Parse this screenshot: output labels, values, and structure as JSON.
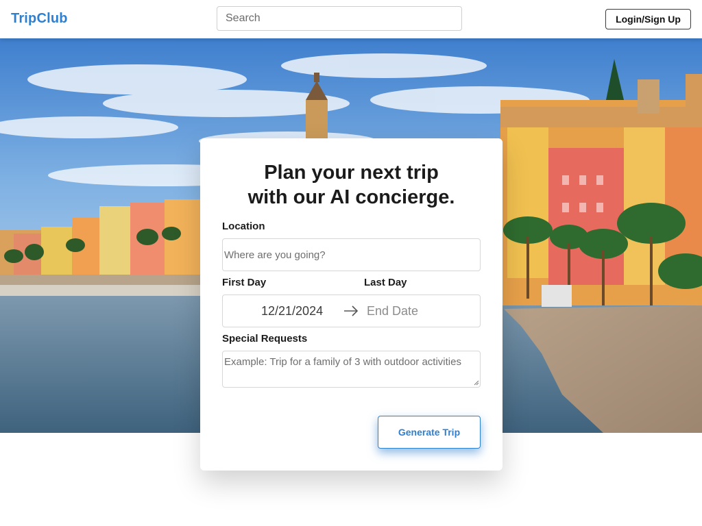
{
  "header": {
    "brand": "TripClub",
    "search_placeholder": "Search",
    "login_label": "Login/Sign Up"
  },
  "hero": {
    "image_icon": "coastal-town-photo"
  },
  "planner": {
    "title_line1": "Plan your next trip",
    "title_line2": "with our AI concierge.",
    "location_label": "Location",
    "location_placeholder": "Where are you going?",
    "first_day_label": "First Day",
    "last_day_label": "Last Day",
    "start_date": "12/21/2024",
    "end_date_placeholder": "End Date",
    "arrow_icon": "arrow-right-icon",
    "special_requests_label": "Special Requests",
    "special_requests_placeholder": "Example: Trip for a family of 3 with outdoor activities",
    "generate_label": "Generate Trip"
  },
  "colors": {
    "brand": "#2f7fd0",
    "accent_glow": "#2f7fd0"
  }
}
